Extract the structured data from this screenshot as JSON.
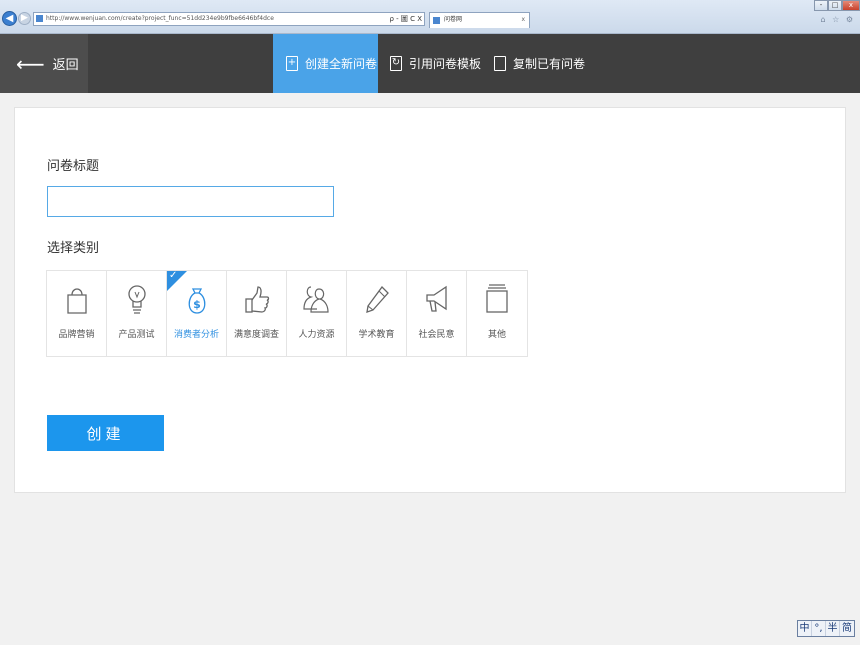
{
  "browser": {
    "url": "http://www.wenjuan.com/create?project_func=51dd234e9b9fbe6646bf4dce",
    "address_buttons": "ρ - 圖 C X",
    "tab_title": "问卷网",
    "tab_close": "x",
    "window_buttons": [
      "-",
      "□",
      "x"
    ],
    "toolbar_icons": "⌂ ☆ ⚙"
  },
  "header": {
    "back_label": "返回",
    "tabs": [
      {
        "label": "创建全新问卷",
        "active": true,
        "icon": "new-doc-icon"
      },
      {
        "label": "引用问卷模板",
        "active": false,
        "icon": "template-doc-icon"
      },
      {
        "label": "复制已有问卷",
        "active": false,
        "icon": "copy-doc-icon"
      }
    ]
  },
  "form": {
    "title_label": "问卷标题",
    "title_value": "",
    "category_label": "选择类别",
    "categories": [
      {
        "label": "品牌营销",
        "icon": "shopping-bag-icon",
        "selected": false
      },
      {
        "label": "产品测试",
        "icon": "lightbulb-icon",
        "selected": false
      },
      {
        "label": "消费者分析",
        "icon": "money-bag-icon",
        "selected": true
      },
      {
        "label": "满意度调查",
        "icon": "thumbs-up-icon",
        "selected": false
      },
      {
        "label": "人力资源",
        "icon": "people-icon",
        "selected": false
      },
      {
        "label": "学术教育",
        "icon": "pencil-icon",
        "selected": false
      },
      {
        "label": "社会民意",
        "icon": "megaphone-icon",
        "selected": false
      },
      {
        "label": "其他",
        "icon": "document-icon",
        "selected": false
      }
    ],
    "selected_check": "✓",
    "create_label": "创建"
  },
  "ime": [
    "中",
    "°,",
    "半",
    "简"
  ],
  "colors": {
    "accent": "#1c96ed",
    "header_bg": "#3f3f3f",
    "active_tab": "#4aa3e8"
  }
}
